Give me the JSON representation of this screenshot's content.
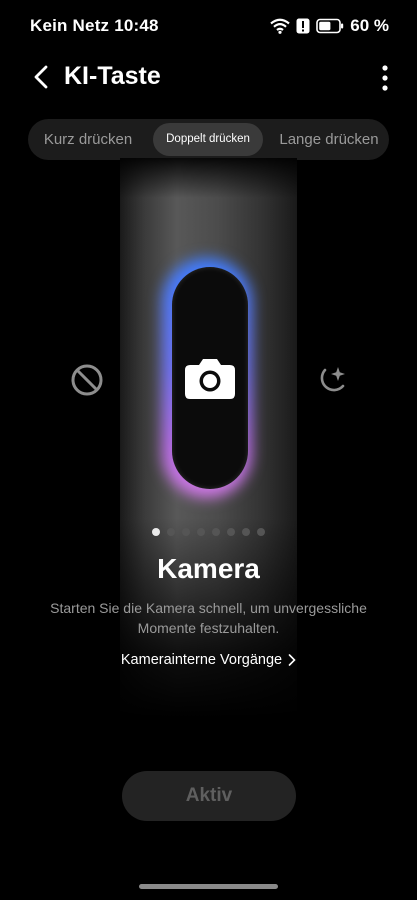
{
  "status_bar": {
    "carrier": "Kein Netz",
    "time": "10:48",
    "battery_percent": "60 %",
    "battery_level": 0.6,
    "icons": [
      "wifi-icon",
      "alert-icon",
      "battery-icon"
    ]
  },
  "header": {
    "title": "KI-Taste",
    "back_icon": "chevron-left-icon",
    "menu_icon": "more-vertical-icon"
  },
  "tabs": [
    {
      "label": "Kurz drücken",
      "selected": false
    },
    {
      "label": "Doppelt drücken",
      "selected": true
    },
    {
      "label": "Lange drücken",
      "selected": false
    }
  ],
  "carousel": {
    "left_icon": "block-icon",
    "center_icon": "camera-icon",
    "right_icon": "ai-sparkle-icon",
    "page_count": 8,
    "current_page": 1,
    "glow_colors": [
      "#3e7dff",
      "#b66be6"
    ]
  },
  "feature": {
    "title": "Kamera",
    "description": "Starten Sie die Kamera schnell, um unvergessliche Momente festzuhalten.",
    "link_label": "Kamerainterne Vorgänge"
  },
  "action_button": {
    "label": "Aktiv"
  }
}
